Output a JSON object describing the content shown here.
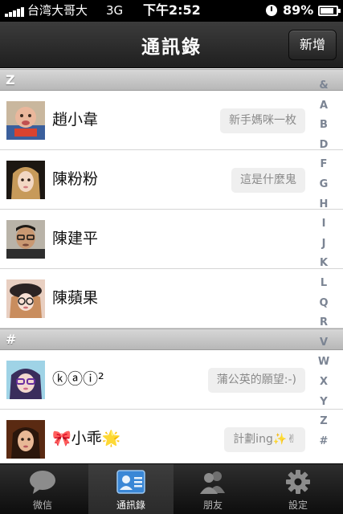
{
  "status_bar": {
    "carrier": "台湾大哥大",
    "network": "3G",
    "time": "下午2:52",
    "battery_percent": "89%",
    "battery_level": 0.89
  },
  "nav": {
    "title": "通訊錄",
    "add_label": "新增"
  },
  "sections": [
    {
      "header": "Z",
      "contacts": [
        {
          "name": "趙小韋",
          "signature": "新手媽咪一枚",
          "avatar": "baby-photo"
        },
        {
          "name": "陳粉粉",
          "signature": "這是什麼鬼",
          "avatar": "girl-photo"
        },
        {
          "name": "陳建平",
          "signature": "",
          "avatar": "man-photo"
        },
        {
          "name": "陳蘋果",
          "signature": "",
          "avatar": "girl-hat-photo"
        }
      ]
    },
    {
      "header": "#",
      "contacts": [
        {
          "name": "ⓚⓐⓘ²",
          "signature": "蒲公英的願望:-)",
          "avatar": "girl-glasses-photo"
        },
        {
          "name": "🎀小乖🌟",
          "signature": "計劃ing✨✌",
          "avatar": "girl-portrait-photo"
        }
      ]
    }
  ],
  "index_letters": [
    "&",
    "A",
    "B",
    "D",
    "F",
    "G",
    "H",
    "I",
    "J",
    "K",
    "L",
    "Q",
    "R",
    "V",
    "W",
    "X",
    "Y",
    "Z",
    "#"
  ],
  "tabs": [
    {
      "label": "微信",
      "icon": "chat-bubble-icon",
      "active": false
    },
    {
      "label": "通訊錄",
      "icon": "contacts-card-icon",
      "active": true
    },
    {
      "label": "朋友",
      "icon": "friends-icon",
      "active": false
    },
    {
      "label": "設定",
      "icon": "gear-icon",
      "active": false
    }
  ],
  "colors": {
    "nav_bg": "#2a2a2a",
    "section_header_bg": "#c4c4c4",
    "index_letter": "#7b8493",
    "tab_active_icon": "#3a87d6"
  }
}
